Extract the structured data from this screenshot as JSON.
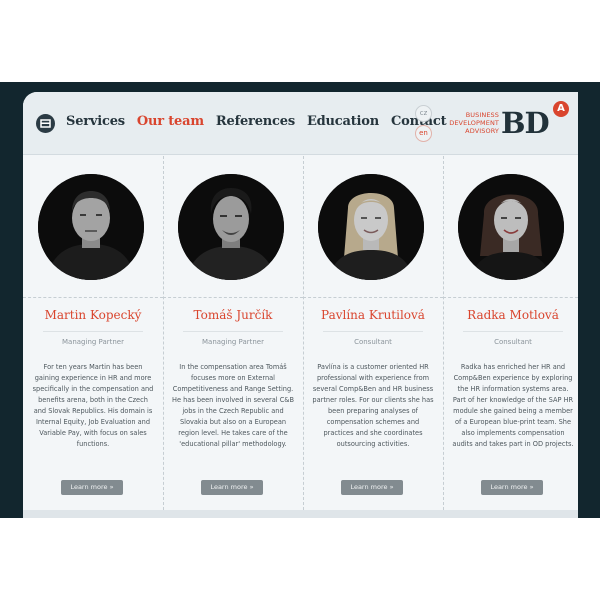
{
  "nav": {
    "home_icon": "home-icon",
    "items": [
      {
        "label": "Services",
        "active": false
      },
      {
        "label": "Our team",
        "active": true
      },
      {
        "label": "References",
        "active": false
      },
      {
        "label": "Education",
        "active": false
      },
      {
        "label": "Contact",
        "active": false
      }
    ]
  },
  "languages": {
    "cz": "cz",
    "en": "en"
  },
  "logo": {
    "line1": "BUSINESS",
    "line2": "DEVELOPMENT",
    "line3": "ADVISORY",
    "mark": "BD",
    "badge": "A"
  },
  "colors": {
    "accent": "#d9452e",
    "frame": "#12262e",
    "text": "#26353d"
  },
  "team": [
    {
      "name": "Martin Kopecký",
      "role": "Managing Partner",
      "bio": "For ten years Martin has been gaining experience in HR and more specifically in the compensation and benefits arena, both in the Czech and Slovak Republics. His domain is Internal Equity, Job Evaluation and Variable Pay, with focus on sales functions.",
      "button": "Learn more »"
    },
    {
      "name": "Tomáš Jurčík",
      "role": "Managing Partner",
      "bio": "In the compensation area Tomáš focuses more on External Competitiveness and Range Setting. He has been involved in several C&B jobs in the Czech Republic and Slovakia but also on a European region level. He takes care of the 'educational pillar' methodology.",
      "button": "Learn more »"
    },
    {
      "name": "Pavlína Krutilová",
      "role": "Consultant",
      "bio": "Pavlína is a customer oriented HR professional with experience from several Comp&Ben and HR business partner roles. For our clients she has been preparing analyses of compensation schemes and practices and she coordinates outsourcing activities.",
      "button": "Learn more »"
    },
    {
      "name": "Radka Motlová",
      "role": "Consultant",
      "bio": "Radka has enriched her HR and Comp&Ben experience by exploring the HR information systems area. Part of her knowledge of the SAP HR module she gained being a member of a European blue-print team. She also implements compensation audits and takes part in OD projects.",
      "button": "Learn more »"
    }
  ]
}
